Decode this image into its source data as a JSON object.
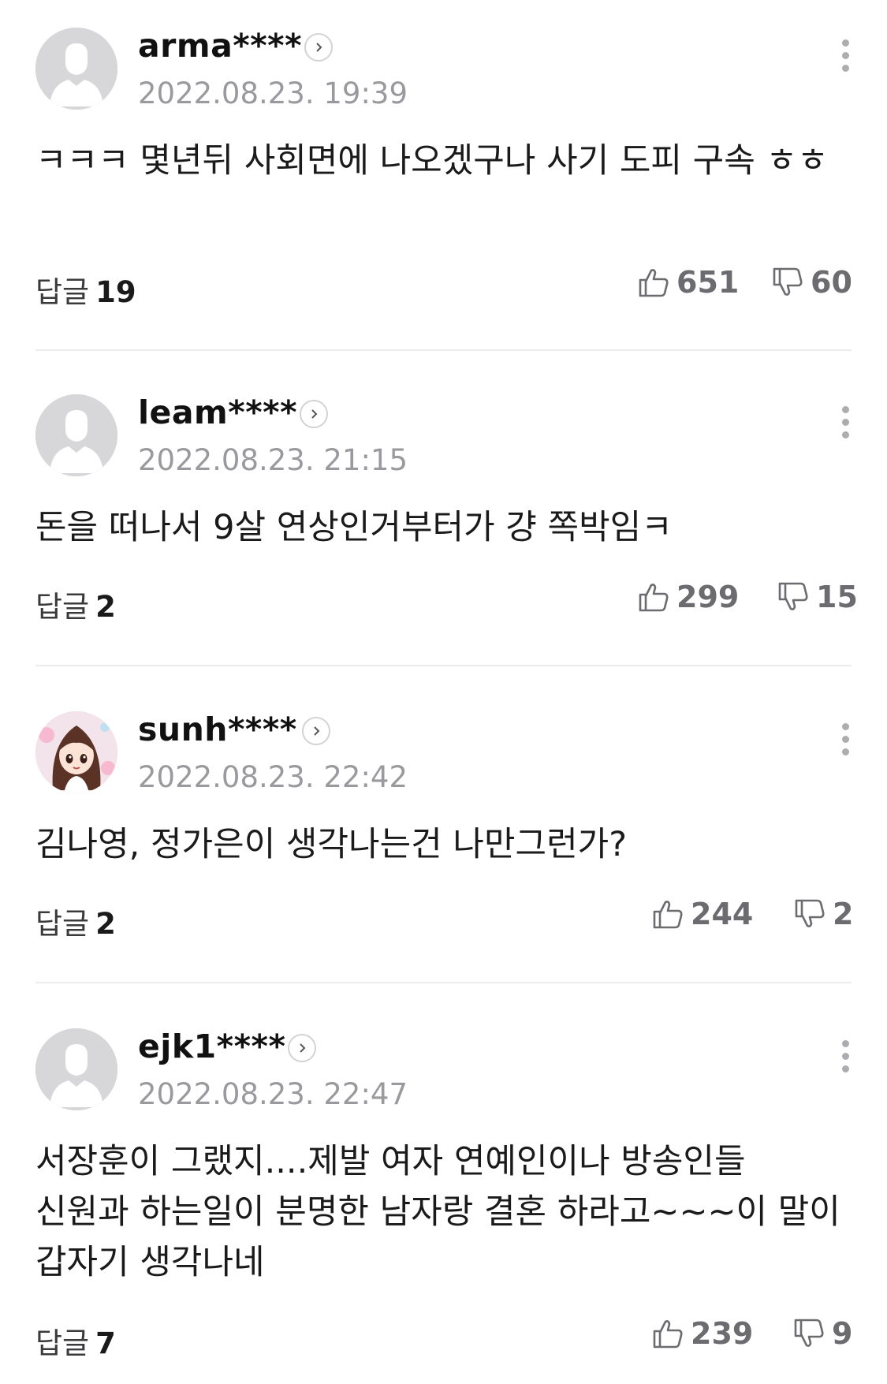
{
  "comments": [
    {
      "nickname": "arma****",
      "date": "2022.08.23. 19:39",
      "avatar": "default-avatar-icon",
      "text": "ㅋㅋㅋ 몇년뒤 사회면에 나오겠구나 사기 도피 구속 ㅎㅎ",
      "reply_label": "답글",
      "reply_count": "19",
      "likes": "651",
      "dislikes": "60"
    },
    {
      "nickname": "leam****",
      "date": "2022.08.23. 21:15",
      "avatar": "default-avatar-icon",
      "text": "돈을 떠나서 9살 연상인거부터가 걍 쪽박임ㅋ",
      "reply_label": "답글",
      "reply_count": "2",
      "likes": "299",
      "dislikes": "15"
    },
    {
      "nickname": "sunh****",
      "date": "2022.08.23. 22:42",
      "avatar": "cartoon-girl-avatar-icon",
      "text": "김나영, 정가은이 생각나는건 나만그런가?",
      "reply_label": "답글",
      "reply_count": "2",
      "likes": "244",
      "dislikes": "2"
    },
    {
      "nickname": "ejk1****",
      "date": "2022.08.23. 22:47",
      "avatar": "default-avatar-icon",
      "text": "서장훈이 그랬지....제발 여자 연예인이나 방송인들 신원과 하는일이 분명한 남자랑 결혼 하라고~~~이 말이 갑자기 생각나네",
      "reply_label": "답글",
      "reply_count": "7",
      "likes": "239",
      "dislikes": "9"
    }
  ],
  "colors": {
    "nickname": "#111111",
    "date": "#9a9a9e",
    "vote": "#6b6b70",
    "divider": "#ececee",
    "avatar_bg": "#d7d7d9"
  }
}
